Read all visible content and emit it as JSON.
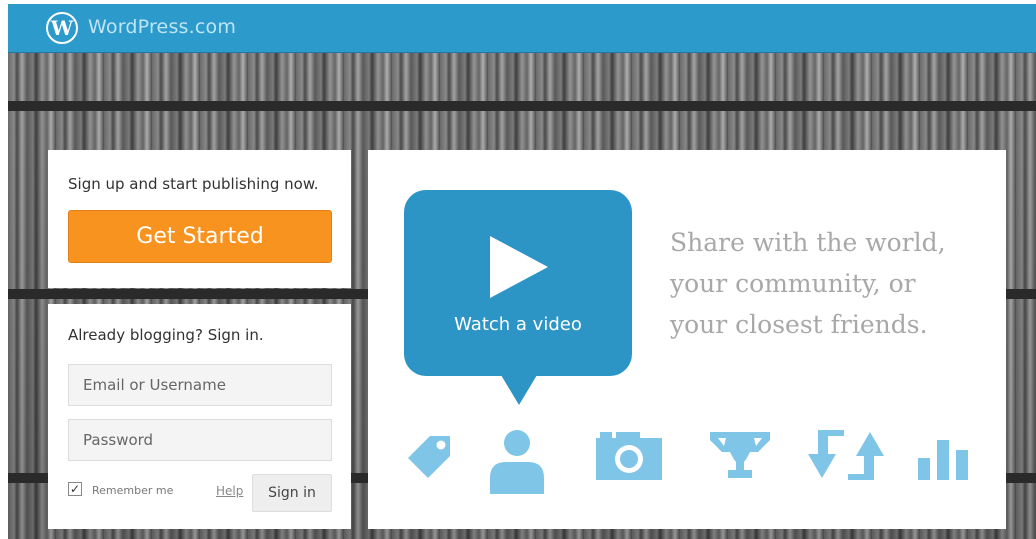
{
  "header": {
    "brand": "WordPress.com",
    "logo_icon": "wordpress-logo-icon"
  },
  "signup": {
    "prompt": "Sign up and start publishing now.",
    "button_label": "Get Started"
  },
  "signin": {
    "title": "Already blogging? Sign in.",
    "email_placeholder": "Email or Username",
    "password_placeholder": "Password",
    "remember_label": "Remember me",
    "remember_checked": true,
    "help_label": "Help",
    "button_label": "Sign in"
  },
  "feature": {
    "video_label": "Watch a video",
    "tagline": [
      "Share with the world,",
      "your community, or",
      "your closest friends."
    ],
    "icons": [
      "tag-icon",
      "person-icon",
      "camera-icon",
      "trophy-icon",
      "reblog-icon",
      "stats-icon"
    ]
  },
  "colors": {
    "topbar": "#2c9bcb",
    "accent_blue": "#2d95c6",
    "icon_blue": "#7ec5e8",
    "button_orange": "#f7931e"
  }
}
